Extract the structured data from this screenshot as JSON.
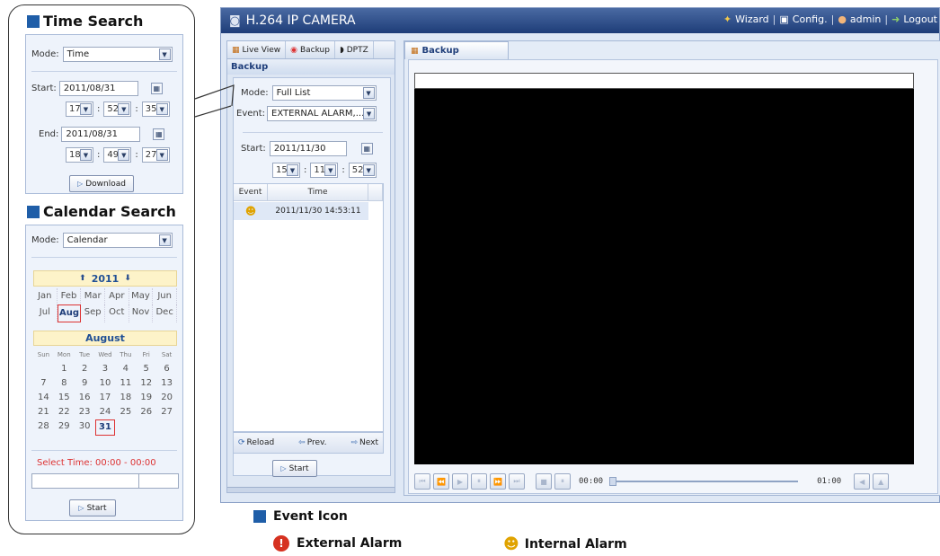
{
  "time_search": {
    "title": "Time Search",
    "mode_label": "Mode:",
    "mode_value": "Time",
    "start_label": "Start:",
    "start_date": "2011/08/31",
    "start_h": "17",
    "start_m": "52",
    "start_s": "35",
    "end_label": "End:",
    "end_date": "2011/08/31",
    "end_h": "18",
    "end_m": "49",
    "end_s": "27",
    "download_label": "Download",
    "colon": ":"
  },
  "calendar_search": {
    "title": "Calendar Search",
    "mode_label": "Mode:",
    "mode_value": "Calendar",
    "year": "2011",
    "months": [
      "Jan",
      "Feb",
      "Mar",
      "Apr",
      "May",
      "Jun",
      "Jul",
      "Aug",
      "Sep",
      "Oct",
      "Nov",
      "Dec"
    ],
    "selected_month": "Aug",
    "month_name": "August",
    "day_names": [
      "Sun",
      "Mon",
      "Tue",
      "Wed",
      "Thu",
      "Fri",
      "Sat"
    ],
    "days": [
      "",
      "1",
      "2",
      "3",
      "4",
      "5",
      "6",
      "7",
      "8",
      "9",
      "10",
      "11",
      "12",
      "13",
      "14",
      "15",
      "16",
      "17",
      "18",
      "19",
      "20",
      "21",
      "22",
      "23",
      "24",
      "25",
      "26",
      "27",
      "28",
      "29",
      "30",
      "31"
    ],
    "selected_day": "31",
    "select_time": "Select Time: 00:00 - 00:00",
    "start_label": "Start"
  },
  "window": {
    "title": "H.264 IP CAMERA",
    "nav": {
      "wizard": "Wizard",
      "config": "Config.",
      "admin": "admin",
      "logout": "Logout"
    }
  },
  "left_panel": {
    "tabs": {
      "live_view": "Live View",
      "backup": "Backup",
      "dptz": "DPTZ"
    },
    "section": "Backup",
    "mode_label": "Mode:",
    "mode_value": "Full List",
    "event_label": "Event:",
    "event_value": "EXTERNAL ALARM,...",
    "start_label": "Start:",
    "start_date": "2011/11/30",
    "start_h": "15",
    "start_m": "11",
    "start_s": "52",
    "table": {
      "col_event": "Event",
      "col_time": "Time",
      "rows": [
        {
          "icon": "internal-alarm",
          "time": "2011/11/30 14:53:11"
        }
      ]
    },
    "reload": "Reload",
    "prev": "Prev.",
    "next": "Next",
    "start_button": "Start"
  },
  "player": {
    "tab": "Backup",
    "time_start": "00:00",
    "time_end": "01:00"
  },
  "legend": {
    "title": "Event Icon",
    "external": "External Alarm",
    "internal": "Internal Alarm"
  },
  "colors": {
    "accent": "#1f5ea8",
    "title_bar": "#1e3d78",
    "selection": "#dd3333",
    "alarm_red": "#d63120",
    "alarm_yellow": "#e0a300"
  }
}
